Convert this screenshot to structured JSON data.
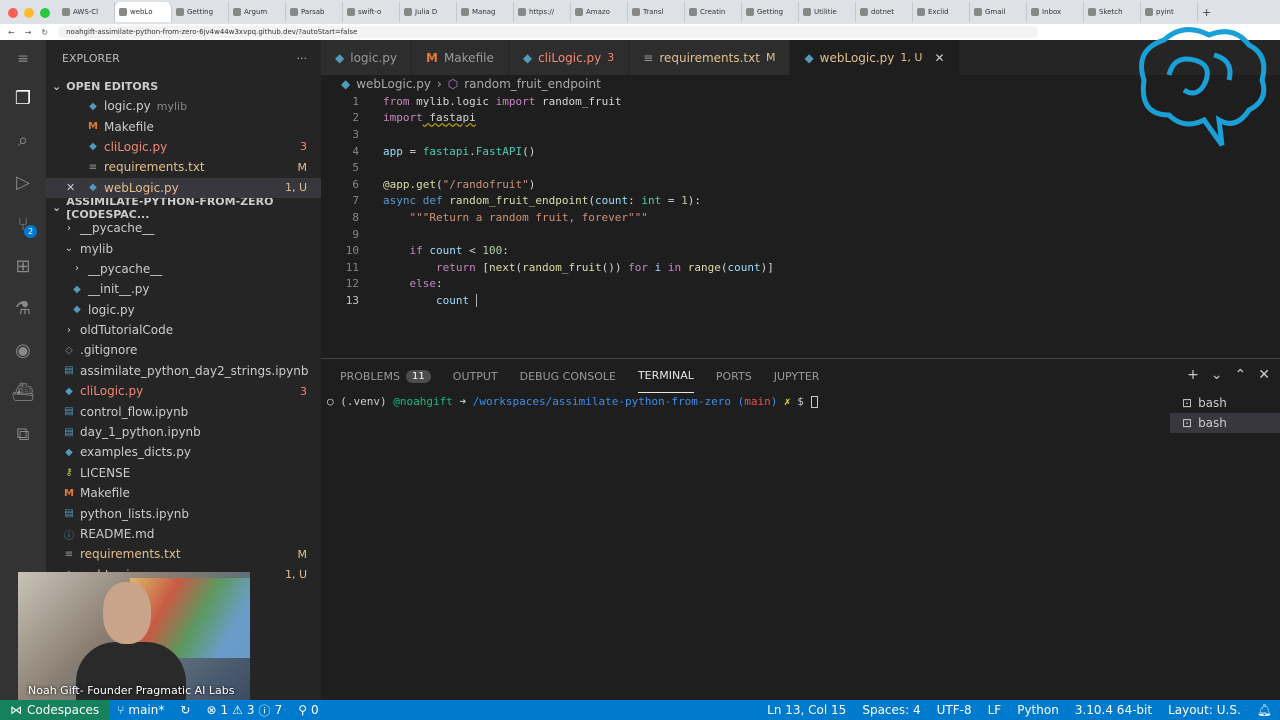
{
  "browser": {
    "tabs": [
      "AWS-Cl",
      "webLo",
      "Getting",
      "Argum",
      "Parsab",
      "swift-o",
      "Julia D",
      "Manag",
      "https://",
      "Amazo",
      "Transl",
      "Creatin",
      "Getting",
      "Utilitie",
      "dotnet",
      "Exclid",
      "Gmail",
      "Inbox",
      "Sketch",
      "pyint"
    ],
    "url": "noahgift-assimilate-python-from-zero-6jv4w44w3xvpq.github.dev/?autoStart=false"
  },
  "explorer": {
    "title": "EXPLORER",
    "open_editors_label": "OPEN EDITORS",
    "open_editors": [
      {
        "name": "logic.py",
        "desc": "mylib",
        "icon": "python-icon",
        "status": "",
        "kind": "normal"
      },
      {
        "name": "Makefile",
        "desc": "",
        "icon": "makefile-icon",
        "status": "",
        "kind": "normal"
      },
      {
        "name": "cliLogic.py",
        "desc": "",
        "icon": "python-icon",
        "status": "3",
        "kind": "err"
      },
      {
        "name": "requirements.txt",
        "desc": "",
        "icon": "text-file-icon",
        "status": "M",
        "kind": "mod"
      },
      {
        "name": "webLogic.py",
        "desc": "",
        "icon": "python-icon",
        "status": "1, U",
        "kind": "mod"
      }
    ],
    "project_label": "ASSIMILATE-PYTHON-FROM-ZERO [CODESPAC...",
    "tree": [
      {
        "name": "__pycache__",
        "kind": "folder",
        "status": ""
      },
      {
        "name": "mylib",
        "kind": "folder-open",
        "status": ""
      },
      {
        "name": "__pycache__",
        "kind": "folder",
        "status": ""
      },
      {
        "name": "__init__.py",
        "kind": "py",
        "status": ""
      },
      {
        "name": "logic.py",
        "kind": "py",
        "status": ""
      },
      {
        "name": "oldTutorialCode",
        "kind": "folder",
        "status": ""
      },
      {
        "name": ".gitignore",
        "kind": "git",
        "status": ""
      },
      {
        "name": "assimilate_python_day2_strings.ipynb",
        "kind": "nb",
        "status": ""
      },
      {
        "name": "cliLogic.py",
        "kind": "py-err",
        "status": "3"
      },
      {
        "name": "control_flow.ipynb",
        "kind": "nb",
        "status": ""
      },
      {
        "name": "day_1_python.ipynb",
        "kind": "nb",
        "status": ""
      },
      {
        "name": "examples_dicts.py",
        "kind": "py",
        "status": ""
      },
      {
        "name": "LICENSE",
        "kind": "lic",
        "status": ""
      },
      {
        "name": "Makefile",
        "kind": "mk",
        "status": ""
      },
      {
        "name": "python_lists.ipynb",
        "kind": "nb",
        "status": ""
      },
      {
        "name": "README.md",
        "kind": "md",
        "status": ""
      },
      {
        "name": "requirements.txt",
        "kind": "txt-mod",
        "status": "M"
      },
      {
        "name": "webLogic.py",
        "kind": "py-mod",
        "status": "1, U"
      }
    ]
  },
  "editor_tabs": [
    {
      "name": "logic.py",
      "status": "",
      "kind": "normal"
    },
    {
      "name": "Makefile",
      "status": "",
      "kind": "mk"
    },
    {
      "name": "cliLogic.py",
      "status": "3",
      "kind": "err"
    },
    {
      "name": "requirements.txt",
      "status": "M",
      "kind": "mod"
    },
    {
      "name": "webLogic.py",
      "status": "1, U",
      "kind": "active"
    }
  ],
  "breadcrumb": {
    "file": "webLogic.py",
    "symbol": "random_fruit_endpoint"
  },
  "code_lines": [
    "1",
    "2",
    "3",
    "4",
    "5",
    "6",
    "7",
    "8",
    "9",
    "10",
    "11",
    "12",
    "13"
  ],
  "code": {
    "l1": [
      "from",
      " mylib.logic ",
      "import",
      " random_fruit"
    ],
    "l2": [
      "import",
      " fastapi"
    ],
    "l4": [
      "app",
      " = ",
      "fastapi",
      ".",
      "FastAPI",
      "()"
    ],
    "l6": [
      "@app.get",
      "(",
      "\"/randofruit\"",
      ")"
    ],
    "l7": [
      "async",
      " ",
      "def",
      " ",
      "random_fruit_endpoint",
      "(",
      "count",
      ": ",
      "int",
      " = ",
      "1",
      "):"
    ],
    "l8": [
      "\"\"\"Return a random fruit, forever\"\"\""
    ],
    "l10": [
      "if",
      " ",
      "count",
      " < ",
      "100",
      ":"
    ],
    "l11": [
      "return",
      " [",
      "next",
      "(",
      "random_fruit",
      "()) ",
      "for",
      " ",
      "i",
      " ",
      "in",
      " ",
      "range",
      "(",
      "count",
      ")]"
    ],
    "l12": [
      "else",
      ":"
    ],
    "l13": [
      "count",
      " "
    ]
  },
  "panel": {
    "tabs": [
      "PROBLEMS",
      "OUTPUT",
      "DEBUG CONSOLE",
      "TERMINAL",
      "PORTS",
      "JUPYTER"
    ],
    "problems_count": "11",
    "terminal": {
      "venv": "(.venv)",
      "user": "@noahgift",
      "arrow": "➜",
      "path": "/workspaces/assimilate-python-from-zero",
      "branch_open": "(",
      "branch": "main",
      "branch_close": ")",
      "dirty": "✗",
      "prompt": "$"
    },
    "terminals": [
      "bash",
      "bash"
    ]
  },
  "status": {
    "remote": "Codespaces",
    "branch": "main*",
    "errors": "1",
    "warnings": "3",
    "infos": "7",
    "ports": "0",
    "position": "Ln 13, Col 15",
    "spaces": "Spaces: 4",
    "encoding": "UTF-8",
    "eol": "LF",
    "language": "Python",
    "interpreter": "3.10.4 64-bit",
    "layout": "Layout: U.S."
  },
  "webcam": {
    "caption": "Noah Gift- Founder Pragmatic AI Labs"
  },
  "colors": {
    "accent": "#007acc",
    "modified": "#e2c08d",
    "error": "#f48771",
    "logo": "#1a9fd6"
  }
}
